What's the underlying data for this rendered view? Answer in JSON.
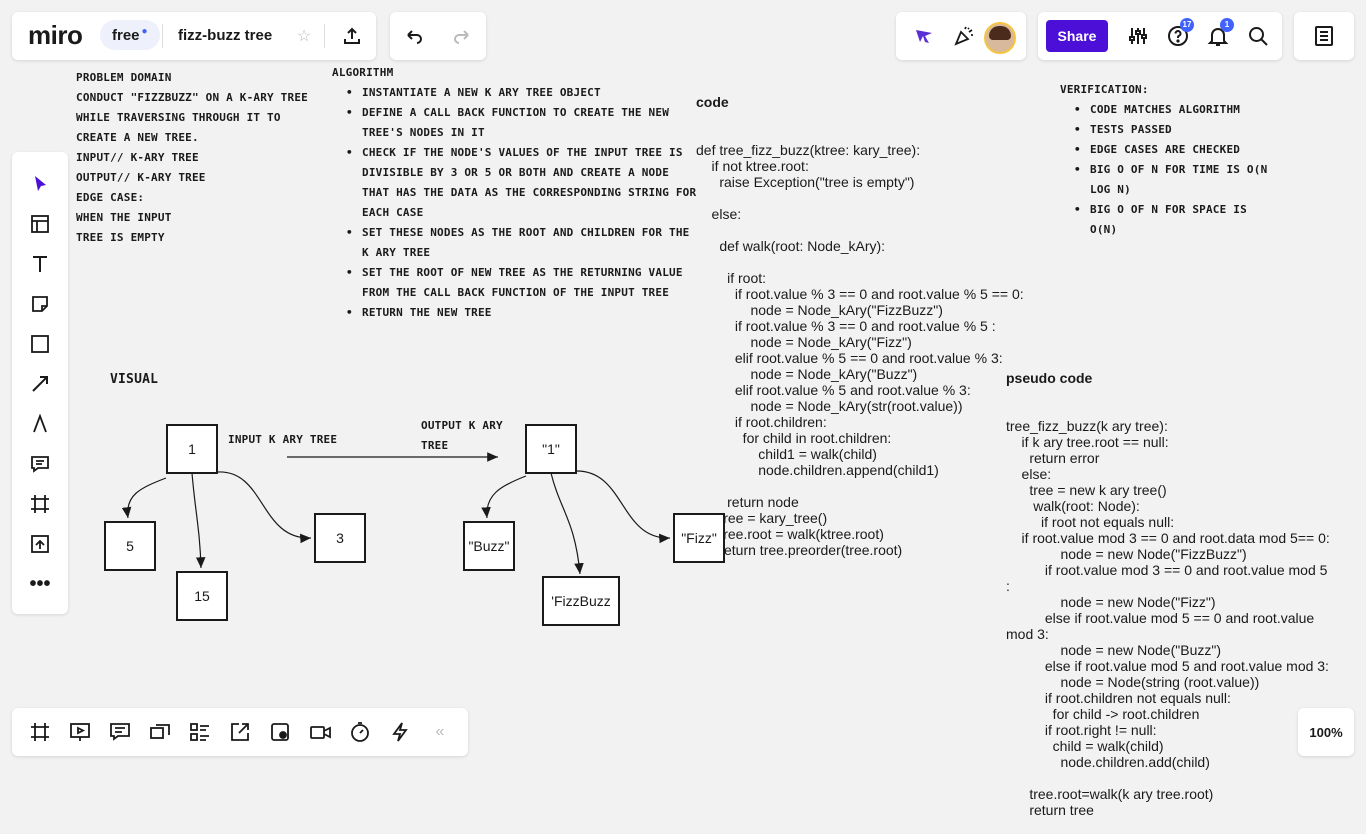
{
  "topbar": {
    "logo": "miro",
    "plan": "free",
    "board_title": "fizz-buzz tree",
    "share_label": "Share",
    "help_badge": "17",
    "notif_badge": "1"
  },
  "zoom": "100%",
  "board": {
    "problem_domain": [
      "Problem Domain",
      "Conduct \"FizzBuzz\" on a k-ary tree",
      "while traversing through it to",
      "create a new tree.",
      "input// k-ary tree",
      "output// k-ary tree",
      "Edge Case:",
      "when the input",
      "tree is empty"
    ],
    "algorithm_title": "Algorithm",
    "algorithm": [
      "instantiate a new k ary tree object",
      "define a call back function to create the new tree's nodes in it",
      "check if the node's values of the input tree is divisible by 3 or 5 or both and create a node that has the data as the corresponding string for each case",
      "set these nodes as the root and children for the k ary tree",
      "set the root of new tree as the returning value from the call back function of the input tree",
      "return the new tree"
    ],
    "verification_title": "Verification:",
    "verification": [
      "code matches algorithm",
      "tests passed",
      "edge cases are checked",
      "big O of n for time is O(n log n)",
      "big O of n for space is O(n)"
    ],
    "code_title": "code",
    "code": "def tree_fizz_buzz(ktree: kary_tree):\n    if not ktree.root:\n      raise Exception(\"tree is empty\")\n\n    else:\n\n      def walk(root: Node_kAry):\n\n        if root:\n          if root.value % 3 == 0 and root.value % 5 == 0:\n              node = Node_kAry(\"FizzBuzz\")\n          if root.value % 3 == 0 and root.value % 5 :\n              node = Node_kAry(\"Fizz\")\n          elif root.value % 5 == 0 and root.value % 3:\n              node = Node_kAry(\"Buzz\")\n          elif root.value % 5 and root.value % 3:\n              node = Node_kAry(str(root.value))\n          if root.children:\n            for child in root.children:\n                child1 = walk(child)\n                node.children.append(child1)\n\n        return node\n      tree = kary_tree()\n      tree.root = walk(ktree.root)\n      return tree.preorder(tree.root)",
    "pseudo_title": "pseudo code",
    "pseudo": "tree_fizz_buzz(k ary tree):\n    if k ary tree.root == null:\n      return error\n    else:\n      tree = new k ary tree()\n       walk(root: Node):\n         if root not equals null:\n    if root.value mod 3 == 0 and root.data mod 5== 0:\n              node = new Node(\"FizzBuzz\")\n          if root.value mod 3 == 0 and root.value mod 5\n:\n              node = new Node(\"Fizz\")\n          else if root.value mod 5 == 0 and root.value\nmod 3:\n              node = new Node(\"Buzz\")\n          else if root.value mod 5 and root.value mod 3:\n              node = Node(string (root.value))\n          if root.children not equals null:\n            for child -> root.children\n          if root.right != null:\n            child = walk(child)\n              node.children.add(child)\n\n      tree.root=walk(k ary tree.root)\n      return tree",
    "visual_title": "Visual",
    "input_label": "input k ary tree",
    "output_label": "output k ary tree",
    "input_nodes": {
      "root": "1",
      "a": "5",
      "b": "15",
      "c": "3"
    },
    "output_nodes": {
      "root": "\"1\"",
      "a": "\"Buzz\"",
      "b": "'FizzBuzz",
      "c": "\"Fizz\""
    }
  }
}
